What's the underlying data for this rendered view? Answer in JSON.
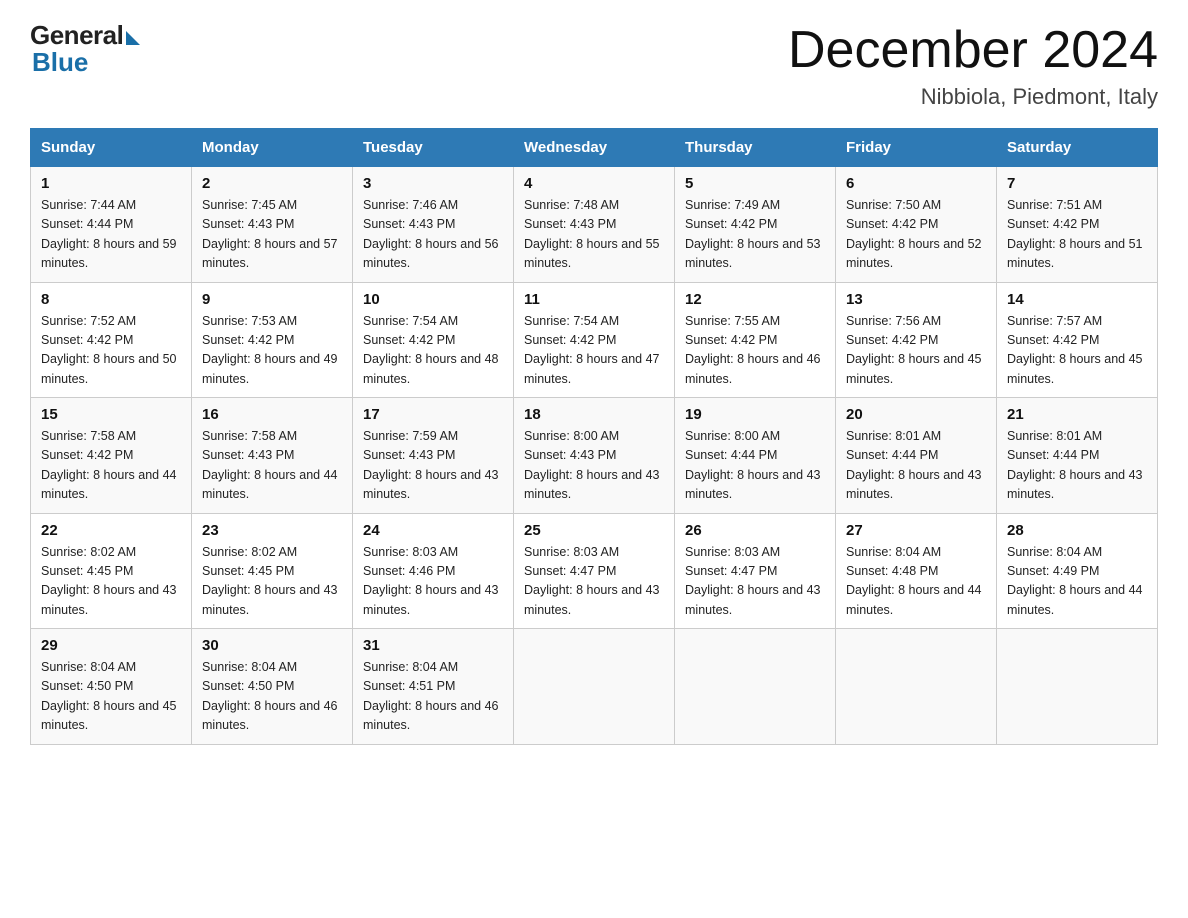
{
  "logo": {
    "general": "General",
    "blue": "Blue"
  },
  "title": {
    "month": "December 2024",
    "location": "Nibbiola, Piedmont, Italy"
  },
  "days_of_week": [
    "Sunday",
    "Monday",
    "Tuesday",
    "Wednesday",
    "Thursday",
    "Friday",
    "Saturday"
  ],
  "weeks": [
    [
      {
        "day": "1",
        "sunrise": "7:44 AM",
        "sunset": "4:44 PM",
        "daylight": "8 hours and 59 minutes."
      },
      {
        "day": "2",
        "sunrise": "7:45 AM",
        "sunset": "4:43 PM",
        "daylight": "8 hours and 57 minutes."
      },
      {
        "day": "3",
        "sunrise": "7:46 AM",
        "sunset": "4:43 PM",
        "daylight": "8 hours and 56 minutes."
      },
      {
        "day": "4",
        "sunrise": "7:48 AM",
        "sunset": "4:43 PM",
        "daylight": "8 hours and 55 minutes."
      },
      {
        "day": "5",
        "sunrise": "7:49 AM",
        "sunset": "4:42 PM",
        "daylight": "8 hours and 53 minutes."
      },
      {
        "day": "6",
        "sunrise": "7:50 AM",
        "sunset": "4:42 PM",
        "daylight": "8 hours and 52 minutes."
      },
      {
        "day": "7",
        "sunrise": "7:51 AM",
        "sunset": "4:42 PM",
        "daylight": "8 hours and 51 minutes."
      }
    ],
    [
      {
        "day": "8",
        "sunrise": "7:52 AM",
        "sunset": "4:42 PM",
        "daylight": "8 hours and 50 minutes."
      },
      {
        "day": "9",
        "sunrise": "7:53 AM",
        "sunset": "4:42 PM",
        "daylight": "8 hours and 49 minutes."
      },
      {
        "day": "10",
        "sunrise": "7:54 AM",
        "sunset": "4:42 PM",
        "daylight": "8 hours and 48 minutes."
      },
      {
        "day": "11",
        "sunrise": "7:54 AM",
        "sunset": "4:42 PM",
        "daylight": "8 hours and 47 minutes."
      },
      {
        "day": "12",
        "sunrise": "7:55 AM",
        "sunset": "4:42 PM",
        "daylight": "8 hours and 46 minutes."
      },
      {
        "day": "13",
        "sunrise": "7:56 AM",
        "sunset": "4:42 PM",
        "daylight": "8 hours and 45 minutes."
      },
      {
        "day": "14",
        "sunrise": "7:57 AM",
        "sunset": "4:42 PM",
        "daylight": "8 hours and 45 minutes."
      }
    ],
    [
      {
        "day": "15",
        "sunrise": "7:58 AM",
        "sunset": "4:42 PM",
        "daylight": "8 hours and 44 minutes."
      },
      {
        "day": "16",
        "sunrise": "7:58 AM",
        "sunset": "4:43 PM",
        "daylight": "8 hours and 44 minutes."
      },
      {
        "day": "17",
        "sunrise": "7:59 AM",
        "sunset": "4:43 PM",
        "daylight": "8 hours and 43 minutes."
      },
      {
        "day": "18",
        "sunrise": "8:00 AM",
        "sunset": "4:43 PM",
        "daylight": "8 hours and 43 minutes."
      },
      {
        "day": "19",
        "sunrise": "8:00 AM",
        "sunset": "4:44 PM",
        "daylight": "8 hours and 43 minutes."
      },
      {
        "day": "20",
        "sunrise": "8:01 AM",
        "sunset": "4:44 PM",
        "daylight": "8 hours and 43 minutes."
      },
      {
        "day": "21",
        "sunrise": "8:01 AM",
        "sunset": "4:44 PM",
        "daylight": "8 hours and 43 minutes."
      }
    ],
    [
      {
        "day": "22",
        "sunrise": "8:02 AM",
        "sunset": "4:45 PM",
        "daylight": "8 hours and 43 minutes."
      },
      {
        "day": "23",
        "sunrise": "8:02 AM",
        "sunset": "4:45 PM",
        "daylight": "8 hours and 43 minutes."
      },
      {
        "day": "24",
        "sunrise": "8:03 AM",
        "sunset": "4:46 PM",
        "daylight": "8 hours and 43 minutes."
      },
      {
        "day": "25",
        "sunrise": "8:03 AM",
        "sunset": "4:47 PM",
        "daylight": "8 hours and 43 minutes."
      },
      {
        "day": "26",
        "sunrise": "8:03 AM",
        "sunset": "4:47 PM",
        "daylight": "8 hours and 43 minutes."
      },
      {
        "day": "27",
        "sunrise": "8:04 AM",
        "sunset": "4:48 PM",
        "daylight": "8 hours and 44 minutes."
      },
      {
        "day": "28",
        "sunrise": "8:04 AM",
        "sunset": "4:49 PM",
        "daylight": "8 hours and 44 minutes."
      }
    ],
    [
      {
        "day": "29",
        "sunrise": "8:04 AM",
        "sunset": "4:50 PM",
        "daylight": "8 hours and 45 minutes."
      },
      {
        "day": "30",
        "sunrise": "8:04 AM",
        "sunset": "4:50 PM",
        "daylight": "8 hours and 46 minutes."
      },
      {
        "day": "31",
        "sunrise": "8:04 AM",
        "sunset": "4:51 PM",
        "daylight": "8 hours and 46 minutes."
      },
      null,
      null,
      null,
      null
    ]
  ]
}
